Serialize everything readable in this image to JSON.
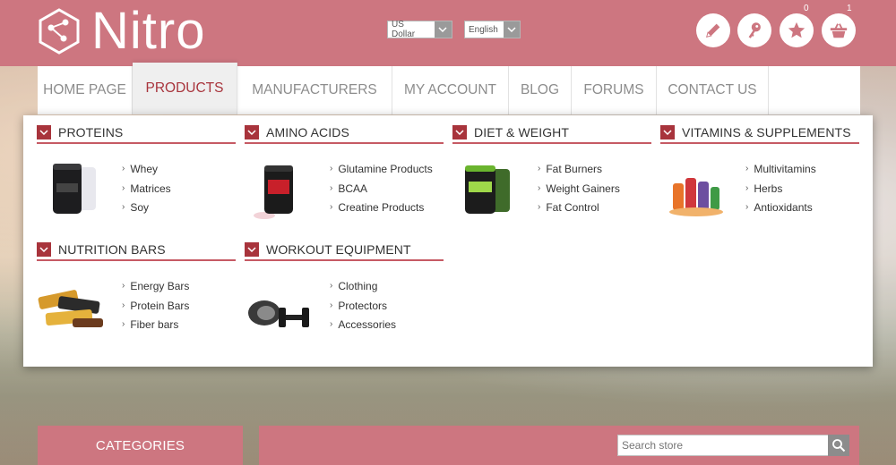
{
  "header": {
    "logo_text": "Nitro",
    "currency": "US Dollar",
    "language": "English",
    "wishlist_count": "0",
    "cart_count": "1",
    "icons": [
      "pencil-icon",
      "key-icon",
      "star-icon",
      "basket-icon"
    ]
  },
  "nav": {
    "items": [
      {
        "label": "HOME PAGE"
      },
      {
        "label": "PRODUCTS"
      },
      {
        "label": "MANUFACTURERS"
      },
      {
        "label": "MY ACCOUNT"
      },
      {
        "label": "BLOG"
      },
      {
        "label": "FORUMS"
      },
      {
        "label": "CONTACT US"
      }
    ],
    "active": "PRODUCTS"
  },
  "mega_menu": {
    "categories": [
      {
        "title": "PROTEINS",
        "links": [
          "Whey",
          "Matrices",
          "Soy"
        ]
      },
      {
        "title": "AMINO ACIDS",
        "links": [
          "Glutamine Products",
          "BCAA",
          "Creatine Products"
        ]
      },
      {
        "title": "DIET & WEIGHT",
        "links": [
          "Fat Burners",
          "Weight Gainers",
          "Fat Control"
        ]
      },
      {
        "title": "VITAMINS & SUPPLEMENTS",
        "links": [
          "Multivitamins",
          "Herbs",
          "Antioxidants"
        ]
      },
      {
        "title": "NUTRITION BARS",
        "links": [
          "Energy Bars",
          "Protein Bars",
          "Fiber bars"
        ]
      },
      {
        "title": "WORKOUT EQUIPMENT",
        "links": [
          "Clothing",
          "Protectors",
          "Accessories"
        ]
      }
    ]
  },
  "sidebar": {
    "categories_label": "CATEGORIES"
  },
  "search": {
    "placeholder": "Search store"
  },
  "colors": {
    "brand": "#cd7680",
    "accent": "#a8343c"
  }
}
